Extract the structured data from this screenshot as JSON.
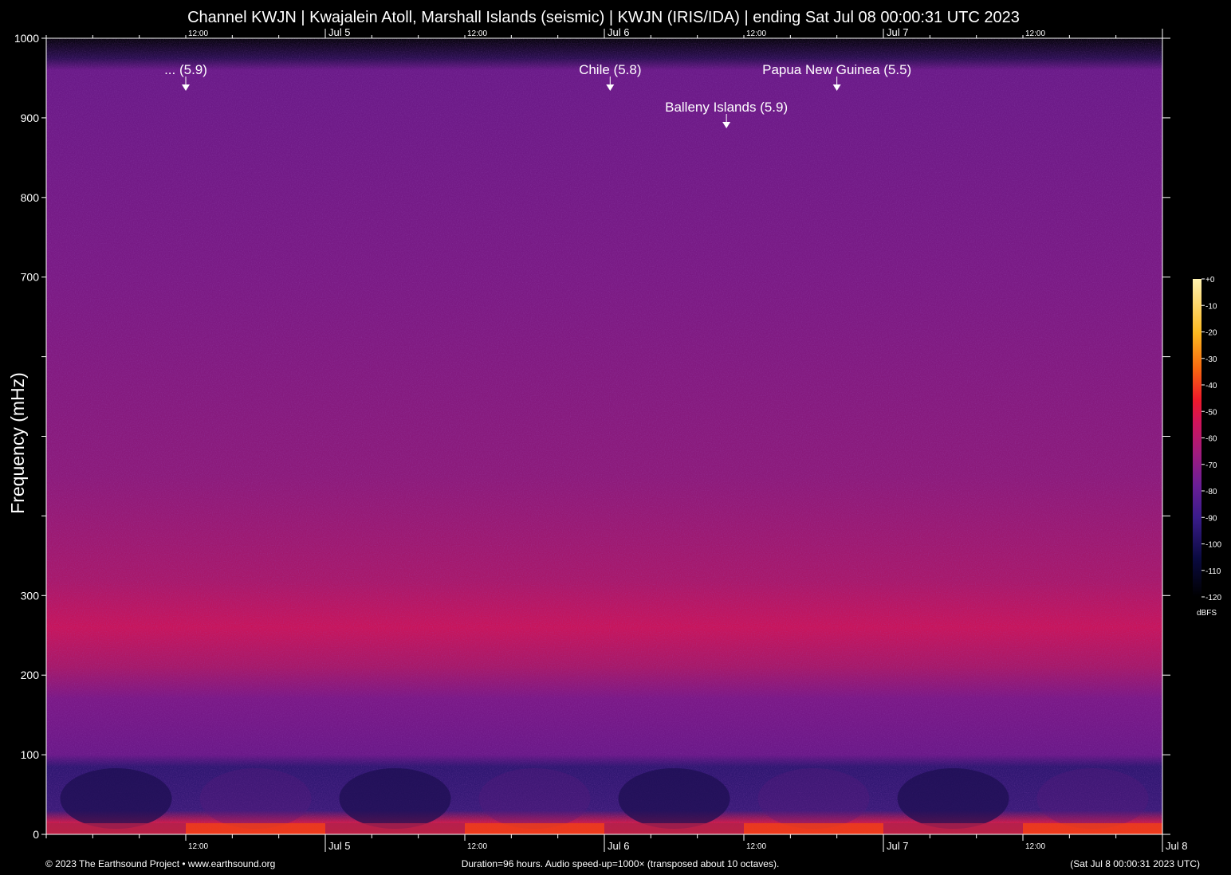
{
  "chart_data": {
    "type": "heatmap",
    "title": "Channel KWJN | Kwajalein Atoll, Marshall Islands (seismic) | KWJN (IRIS/IDA) | ending Sat Jul 08 00:00:31 UTC 2023",
    "ylabel": "Frequency (mHz)",
    "ylim": [
      0,
      1000
    ],
    "y_ticks": [
      {
        "value": 0,
        "label": "0"
      },
      {
        "value": 100,
        "label": "100"
      },
      {
        "value": 200,
        "label": "200"
      },
      {
        "value": 300,
        "label": "300"
      },
      {
        "value": 400,
        "label": ""
      },
      {
        "value": 500,
        "label": ""
      },
      {
        "value": 600,
        "label": ""
      },
      {
        "value": 700,
        "label": "700"
      },
      {
        "value": 800,
        "label": "800"
      },
      {
        "value": 900,
        "label": "900"
      },
      {
        "value": 1000,
        "label": "1000"
      }
    ],
    "x_range_hours": [
      0,
      96
    ],
    "x_major_ticks": [
      {
        "hour": 24,
        "label": "Jul 5"
      },
      {
        "hour": 48,
        "label": "Jul 6"
      },
      {
        "hour": 72,
        "label": "Jul 7"
      },
      {
        "hour": 96,
        "label": "Jul 8"
      }
    ],
    "x_minor_ticks_labeled": [
      {
        "hour": 12,
        "label": "12:00"
      },
      {
        "hour": 36,
        "label": "12:00"
      },
      {
        "hour": 60,
        "label": "12:00"
      },
      {
        "hour": 84,
        "label": "12:00"
      }
    ],
    "x_minor_tick_interval_hours": 4,
    "events": [
      {
        "label": "... (5.9)",
        "hour": 12.0,
        "row": 0
      },
      {
        "label": "Chile (5.8)",
        "hour": 48.5,
        "row": 0
      },
      {
        "label": "Papua New Guinea (5.5)",
        "hour": 68.0,
        "row": 0
      },
      {
        "label": "Balleny Islands (5.9)",
        "hour": 58.5,
        "row": 1
      }
    ],
    "colorbar": {
      "ticks": [
        "+0",
        "-10",
        "-20",
        "-30",
        "-40",
        "-50",
        "-60",
        "-70",
        "-80",
        "-90",
        "-100",
        "-110",
        "-120"
      ],
      "unit": "dBFS",
      "colors": [
        "#000000",
        "#0a0a40",
        "#3a1c8a",
        "#6a1e96",
        "#a01c7e",
        "#d0145a",
        "#ee1a2a",
        "#f86a10",
        "#fcb820",
        "#fff2b0"
      ]
    },
    "description_bands": [
      {
        "from": 0,
        "to": 15,
        "level_dbfs": -45
      },
      {
        "from": 15,
        "to": 90,
        "level_dbfs": -95
      },
      {
        "from": 90,
        "to": 200,
        "level_dbfs": -82
      },
      {
        "from": 200,
        "to": 320,
        "level_dbfs": -65
      },
      {
        "from": 320,
        "to": 980,
        "level_dbfs": -80
      },
      {
        "from": 980,
        "to": 1000,
        "level_dbfs": -120
      }
    ]
  },
  "footer": {
    "left": "© 2023 The Earthsound Project • www.earthsound.org",
    "center": "Duration=96 hours. Audio speed-up=1000× (transposed about 10 octaves).",
    "right": "(Sat Jul  8 00:00:31 2023 UTC)"
  }
}
